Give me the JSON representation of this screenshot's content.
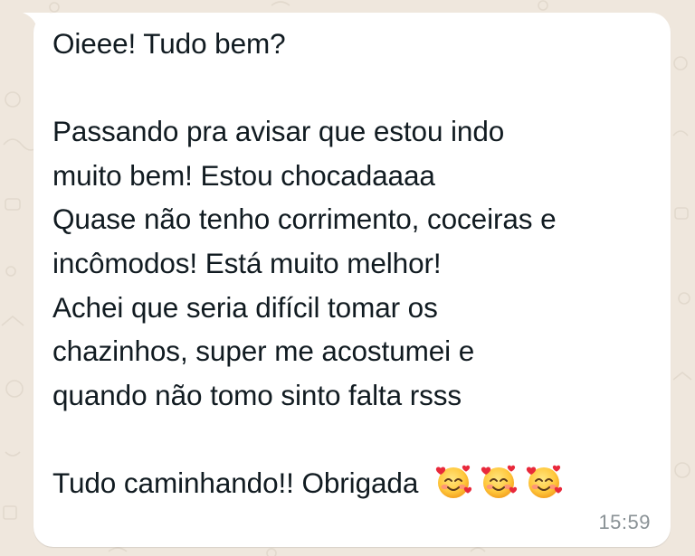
{
  "chat": {
    "background_color": "#efe7dd",
    "bubble_color": "#ffffff",
    "text_color": "#111b21",
    "timestamp_color": "#8a9296"
  },
  "message": {
    "lines": [
      "Oieee! Tudo bem?",
      "",
      "Passando pra avisar que estou indo",
      "muito bem! Estou chocadaaaa",
      "Quase não tenho corrimento, coceiras e",
      "incômodos! Está muito melhor!",
      "Achei que seria difícil tomar os",
      "chazinhos, super me acostumei e",
      "quando não tomo sinto falta rsss",
      "",
      "Tudo caminhando!! Obrigada"
    ],
    "emojis": [
      "smiling-face-with-hearts-icon",
      "smiling-face-with-hearts-icon",
      "smiling-face-with-hearts-icon"
    ],
    "timestamp": "15:59"
  }
}
